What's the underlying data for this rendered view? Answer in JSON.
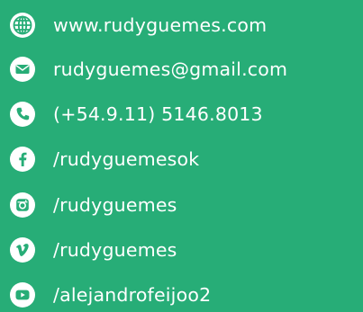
{
  "colors": {
    "background": "#27ad77",
    "text": "#ffffff",
    "icon_fill": "#ffffff",
    "icon_glyph": "#27ad77"
  },
  "contacts": [
    {
      "icon": "globe-icon",
      "text": "www.rudyguemes.com"
    },
    {
      "icon": "mail-icon",
      "text": "rudyguemes@gmail.com"
    },
    {
      "icon": "phone-icon",
      "text": "(+54.9.11) 5146.8013"
    },
    {
      "icon": "facebook-icon",
      "text": "/rudyguemesok"
    },
    {
      "icon": "instagram-icon",
      "text": "/rudyguemes"
    },
    {
      "icon": "vimeo-icon",
      "text": "/rudyguemes"
    },
    {
      "icon": "youtube-icon",
      "text": "/alejandrofeijoo2"
    }
  ]
}
